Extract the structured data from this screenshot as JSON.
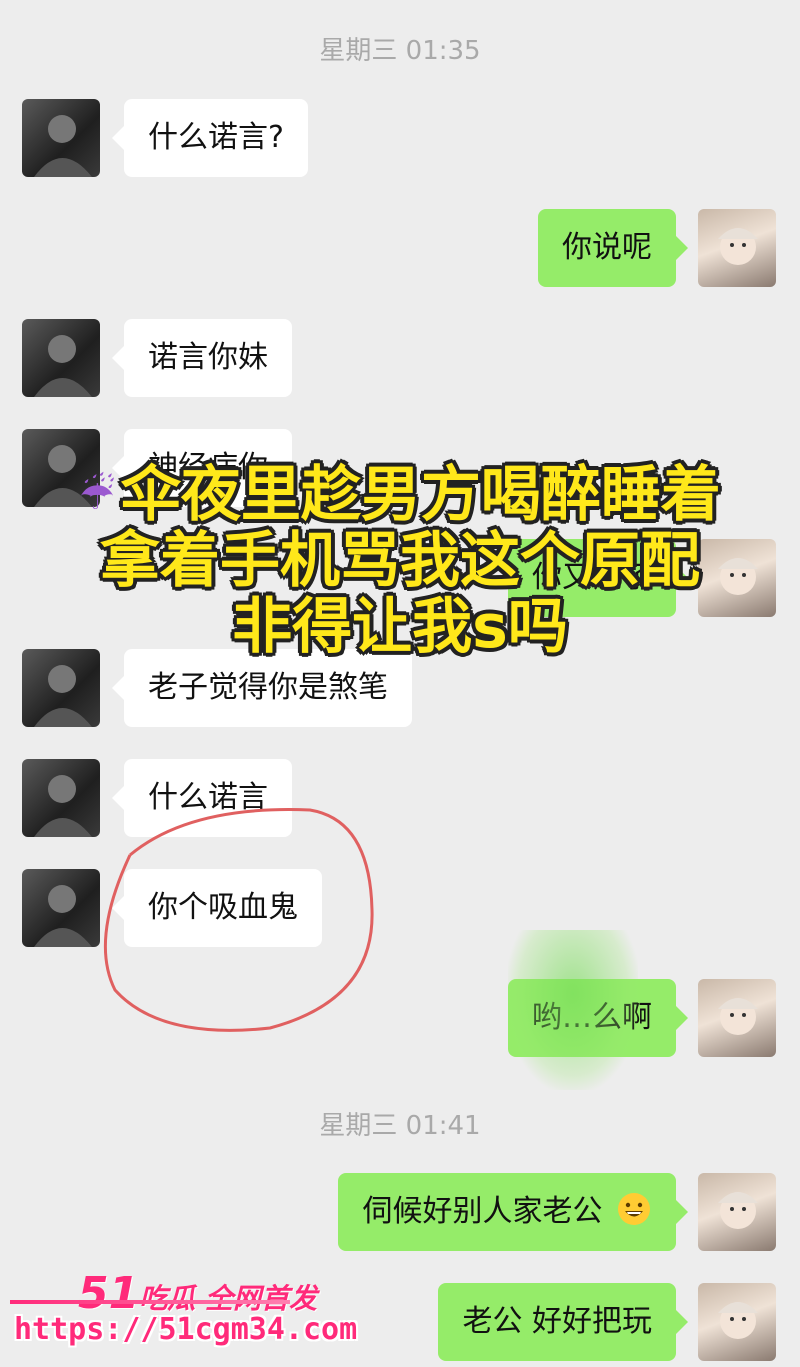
{
  "timestamps": [
    "星期三 01:35",
    "星期三 01:41"
  ],
  "messages": [
    {
      "side": "left",
      "text": "什么诺言?"
    },
    {
      "side": "right",
      "text": "你说呢"
    },
    {
      "side": "left",
      "text": "诺言你妹"
    },
    {
      "side": "left",
      "text": "神经病你"
    },
    {
      "side": "right",
      "text": "你又疯了"
    },
    {
      "side": "left",
      "text": "老子觉得你是煞笔"
    },
    {
      "side": "left",
      "text": "什么诺言"
    },
    {
      "side": "left",
      "text": "你个吸血鬼"
    },
    {
      "side": "right",
      "text": "哟…么啊"
    },
    {
      "side": "right",
      "text": "伺候好别人家老公"
    },
    {
      "side": "right",
      "text": "老公 好好把玩"
    }
  ],
  "overlay": {
    "line1": "伞夜里趁男方喝醉睡着",
    "line2": "拿着手机骂我这个原配",
    "line3": "非得让我s吗",
    "umbrella_icon": "umbrella-rain-icon"
  },
  "watermark": {
    "number": "51",
    "brand": "吃瓜 全网首发",
    "url": "https://51cgm34.com"
  },
  "colors": {
    "background": "#ededed",
    "left_bubble": "#ffffff",
    "right_bubble": "#95ec69",
    "overlay_text": "#ffe81a",
    "annotation_circle": "#e06060",
    "watermark": "#ff2a7a"
  }
}
